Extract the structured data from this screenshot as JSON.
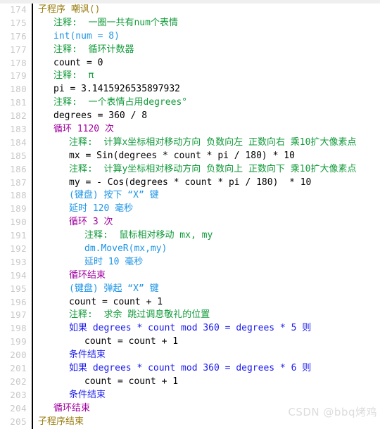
{
  "editor": {
    "title": "code-listing",
    "language": "chinese-visual-basic",
    "first_line_number": 174,
    "last_line_number": 205,
    "watermark": "CSDN @bbq烤鸡",
    "colors": {
      "background": "#ffffff",
      "gutter_text": "#c8c8c8",
      "gutter_rule": "#000000",
      "subroutine": "#9a7d11",
      "comment": "#119a3a",
      "plain": "#000000",
      "loop": "#a000a0",
      "condition": "#1a1aee",
      "action": "#1e95e6",
      "watermark": "#dcdcdc",
      "top_strip": "#efefef"
    }
  },
  "lines": [
    {
      "num": "174",
      "indent": 0,
      "kind": "subroutine",
      "text": "子程序 嘲讽()"
    },
    {
      "num": "175",
      "indent": 1,
      "kind": "comment",
      "text": "注释:  一圈一共有num个表情"
    },
    {
      "num": "176",
      "indent": 1,
      "kind": "action",
      "text": "int(num = 8)"
    },
    {
      "num": "177",
      "indent": 1,
      "kind": "comment",
      "text": "注释:  循环计数器"
    },
    {
      "num": "178",
      "indent": 1,
      "kind": "plain",
      "text": "count = 0"
    },
    {
      "num": "179",
      "indent": 1,
      "kind": "comment",
      "text": "注释:  π"
    },
    {
      "num": "180",
      "indent": 1,
      "kind": "plain",
      "text": "pi = 3.1415926535897932"
    },
    {
      "num": "181",
      "indent": 1,
      "kind": "comment",
      "text": "注释:  一个表情占用degrees°"
    },
    {
      "num": "182",
      "indent": 1,
      "kind": "plain",
      "text": "degrees = 360 / 8"
    },
    {
      "num": "183",
      "indent": 1,
      "kind": "loop",
      "text": "循环 1120 次"
    },
    {
      "num": "184",
      "indent": 2,
      "kind": "comment",
      "text": "注释:  计算x坐标相对移动方向 负数向左 正数向右 乘10扩大像素点"
    },
    {
      "num": "185",
      "indent": 2,
      "kind": "plain",
      "text": "mx = Sin(degrees * count * pi / 180) * 10"
    },
    {
      "num": "186",
      "indent": 2,
      "kind": "comment",
      "text": "注释:  计算y坐标相对移动方向 负数向上 正数向下 乘10扩大像素点"
    },
    {
      "num": "187",
      "indent": 2,
      "kind": "plain",
      "text": "my = - Cos(degrees * count * pi / 180)  * 10"
    },
    {
      "num": "188",
      "indent": 2,
      "kind": "action",
      "text": "(键盘) 按下 “X” 键"
    },
    {
      "num": "189",
      "indent": 2,
      "kind": "action",
      "text": "延时 120 毫秒"
    },
    {
      "num": "190",
      "indent": 2,
      "kind": "loop",
      "text": "循环 3 次"
    },
    {
      "num": "191",
      "indent": 3,
      "kind": "comment",
      "text": "注释:  鼠标相对移动 mx, my"
    },
    {
      "num": "192",
      "indent": 3,
      "kind": "action",
      "text": "dm.MoveR(mx,my)"
    },
    {
      "num": "193",
      "indent": 3,
      "kind": "action",
      "text": "延时 10 毫秒"
    },
    {
      "num": "194",
      "indent": 2,
      "kind": "loop",
      "text": "循环结束"
    },
    {
      "num": "195",
      "indent": 2,
      "kind": "action",
      "text": "(键盘) 弹起 “X” 键"
    },
    {
      "num": "196",
      "indent": 2,
      "kind": "plain",
      "text": "count = count + 1"
    },
    {
      "num": "197",
      "indent": 2,
      "kind": "comment",
      "text": "注释:  求余 跳过调息敬礼的位置"
    },
    {
      "num": "198",
      "indent": 2,
      "kind": "condition",
      "text": "如果 degrees * count mod 360 = degrees * 5 则"
    },
    {
      "num": "199",
      "indent": 3,
      "kind": "plain",
      "text": "count = count + 1"
    },
    {
      "num": "200",
      "indent": 2,
      "kind": "condition",
      "text": "条件结束"
    },
    {
      "num": "201",
      "indent": 2,
      "kind": "condition",
      "text": "如果 degrees * count mod 360 = degrees * 6 则"
    },
    {
      "num": "202",
      "indent": 3,
      "kind": "plain",
      "text": "count = count + 1"
    },
    {
      "num": "203",
      "indent": 2,
      "kind": "condition",
      "text": "条件结束"
    },
    {
      "num": "204",
      "indent": 1,
      "kind": "loop",
      "text": "循环结束"
    },
    {
      "num": "205",
      "indent": 0,
      "kind": "subroutine",
      "text": "子程序结束"
    }
  ]
}
